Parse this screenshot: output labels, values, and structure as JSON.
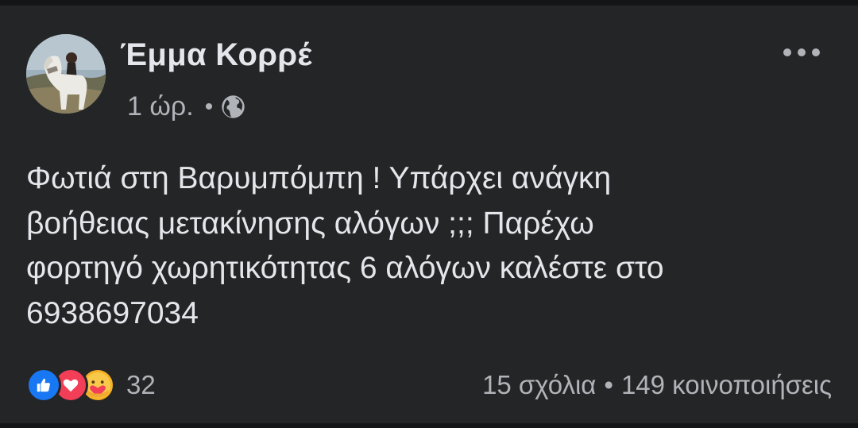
{
  "post": {
    "author": "Έμμα Κορρέ",
    "time": "1 ώρ.",
    "separator": "•",
    "privacy_icon": "globe-icon",
    "more_icon": "more-options-icon",
    "text": "Φωτιά στη Βαρυμπόμπη ! Υπάρχει ανάγκη\nβοήθειας μετακίνησης αλόγων ;;; Παρέχω\nφορτηγό χωρητικότητας 6 αλόγων καλέστε στο\n6938697034"
  },
  "footer": {
    "reactions": [
      "like-icon",
      "love-icon",
      "care-icon"
    ],
    "reaction_count": "32",
    "comments": "15 σχόλια",
    "separator": "•",
    "shares": "149 κοινοποιήσεις"
  },
  "colors": {
    "background": "#242526",
    "primary_text": "#e4e6eb",
    "secondary_text": "#b0b3b8",
    "like": "#1877f2",
    "love": "#f33e58",
    "care": "#f7b125"
  }
}
